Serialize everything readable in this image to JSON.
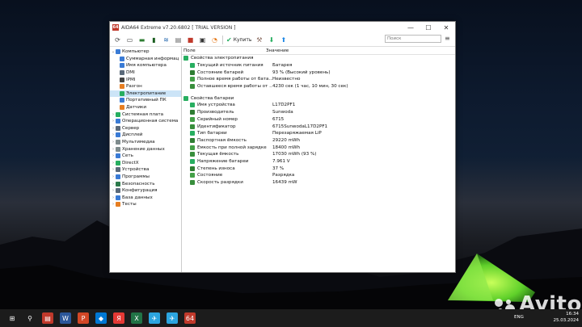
{
  "window": {
    "title": "AIDA64 Extreme v7.20.6802  [ TRIAL VERSION ]",
    "app_icon_text": "64",
    "minimize": "—",
    "maximize": "☐",
    "close": "✕"
  },
  "toolbar": {
    "buy_label": "Купить",
    "search_placeholder": "Поиск"
  },
  "tree": [
    {
      "label": "Компьютер",
      "level": 0,
      "expand": "⌄",
      "color": "#3a7bd5"
    },
    {
      "label": "Суммарная информац",
      "level": 1,
      "color": "#3a7bd5"
    },
    {
      "label": "Имя компьютера",
      "level": 1,
      "color": "#3a7bd5"
    },
    {
      "label": "DMI",
      "level": 1,
      "color": "#5b6a7a"
    },
    {
      "label": "IPMI",
      "level": 1,
      "color": "#444444"
    },
    {
      "label": "Разгон",
      "level": 1,
      "color": "#e67e22"
    },
    {
      "label": "Электропитание",
      "level": 1,
      "color": "#27ae60",
      "selected": true
    },
    {
      "label": "Портативный ПК",
      "level": 1,
      "color": "#3a7bd5"
    },
    {
      "label": "Датчики",
      "level": 1,
      "color": "#e67e22"
    },
    {
      "label": "Системная плата",
      "level": 0,
      "expand": "›",
      "color": "#27ae60"
    },
    {
      "label": "Операционная система",
      "level": 0,
      "expand": "›",
      "color": "#3a7bd5"
    },
    {
      "label": "Сервер",
      "level": 0,
      "expand": "›",
      "color": "#5b6a7a"
    },
    {
      "label": "Дисплей",
      "level": 0,
      "expand": "›",
      "color": "#3a7bd5"
    },
    {
      "label": "Мультимедиа",
      "level": 0,
      "expand": "›",
      "color": "#7f8c8d"
    },
    {
      "label": "Хранение данных",
      "level": 0,
      "expand": "›",
      "color": "#7f8c8d"
    },
    {
      "label": "Сеть",
      "level": 0,
      "expand": "›",
      "color": "#3a7bd5"
    },
    {
      "label": "DirectX",
      "level": 0,
      "expand": "›",
      "color": "#27ae60"
    },
    {
      "label": "Устройства",
      "level": 0,
      "expand": "›",
      "color": "#5b6a7a"
    },
    {
      "label": "Программы",
      "level": 0,
      "expand": "›",
      "color": "#3a7bd5"
    },
    {
      "label": "Безопасность",
      "level": 0,
      "expand": "›",
      "color": "#2c7a4b"
    },
    {
      "label": "Конфигурация",
      "level": 0,
      "expand": "›",
      "color": "#5b6a7a"
    },
    {
      "label": "База данных",
      "level": 0,
      "expand": "›",
      "color": "#3a7bd5"
    },
    {
      "label": "Тесты",
      "level": 0,
      "expand": "›",
      "color": "#e67e22"
    }
  ],
  "list": {
    "col_field": "Поле",
    "col_value": "Значение",
    "sections": [
      {
        "title": "Свойства электропитания",
        "rows": [
          {
            "field": "Текущий источник питания",
            "value": "Батарея"
          },
          {
            "field": "Состояние батарей",
            "value": "93 % (Высокий уровень)"
          },
          {
            "field": "Полное время работы от бата...",
            "value": "Неизвестно"
          },
          {
            "field": "Оставшееся время работы от ...",
            "value": "4230 сек (1 час, 10 мин, 30 сек)"
          }
        ]
      },
      {
        "title": "Свойства батареи",
        "rows": [
          {
            "field": "Имя устройства",
            "value": "L17D2PF1"
          },
          {
            "field": "Производитель",
            "value": "Sunwoda"
          },
          {
            "field": "Серийный номер",
            "value": "6715"
          },
          {
            "field": "Идентификатор",
            "value": "6715SunwodaL17D2PF1"
          },
          {
            "field": "Тип батареи",
            "value": "Перезаряжаемая LiP"
          },
          {
            "field": "Паспортная ёмкость",
            "value": "29220 mWh"
          },
          {
            "field": "Ёмкость при полной зарядке",
            "value": "18400 mWh"
          },
          {
            "field": "Текущая ёмкость",
            "value": "17030 mWh  (93 %)"
          },
          {
            "field": "Напряжение батареи",
            "value": "7.961 V"
          },
          {
            "field": "Степень износа",
            "value": "37 %"
          },
          {
            "field": "Состояние",
            "value": "Разрядка"
          },
          {
            "field": "Скорость разрядки",
            "value": "16439 mW"
          }
        ]
      }
    ]
  },
  "taskbar": {
    "items": [
      "⊞",
      "⚲",
      "▤",
      "W",
      "P",
      "◆",
      "Я",
      "X",
      "✈",
      "✈",
      "64"
    ],
    "lang": "ENG",
    "time": "16:34",
    "date": "25.03.2024"
  },
  "watermark": "Avito"
}
